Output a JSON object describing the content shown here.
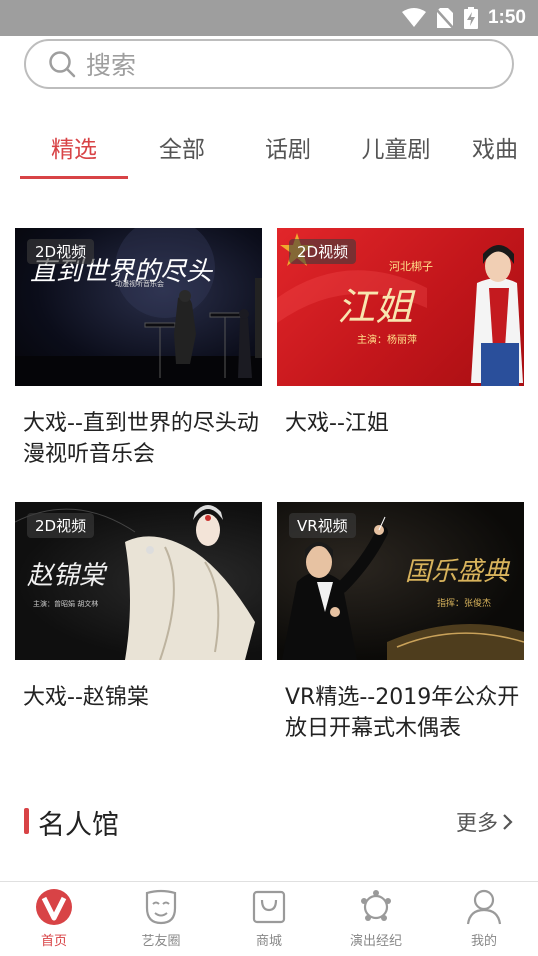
{
  "status_bar": {
    "time": "1:50"
  },
  "search": {
    "placeholder": "搜索"
  },
  "tabs": [
    {
      "label": "精选",
      "active": true
    },
    {
      "label": "全部",
      "active": false
    },
    {
      "label": "话剧",
      "active": false
    },
    {
      "label": "儿童剧",
      "active": false
    },
    {
      "label": "戏曲",
      "active": false
    }
  ],
  "cards": [
    {
      "badge": "2D视频",
      "title": "大戏--直到世界的尽头动漫视听音乐会",
      "thumb_text": "直到世界的尽头",
      "thumb_sub": "动漫视听音乐会"
    },
    {
      "badge": "2D视频",
      "title": "大戏--江姐",
      "thumb_text": "江姐",
      "thumb_top": "河北梆子",
      "thumb_sub": "主演：杨丽萍"
    },
    {
      "badge": "2D视频",
      "title": "大戏--赵锦棠",
      "thumb_text": "赵锦棠",
      "thumb_sub": "主演：曾昭娟 胡文林"
    },
    {
      "badge": "VR视频",
      "title": "VR精选--2019年公众开放日开幕式木偶表",
      "thumb_text": "国乐盛典",
      "thumb_sub": "指挥：张俊杰"
    }
  ],
  "section": {
    "title": "名人馆",
    "more_label": "更多"
  },
  "bottom_nav": [
    {
      "label": "首页",
      "icon": "home-v-icon",
      "active": true
    },
    {
      "label": "艺友圈",
      "icon": "mask-icon",
      "active": false
    },
    {
      "label": "商城",
      "icon": "shopping-bag-icon",
      "active": false
    },
    {
      "label": "演出经纪",
      "icon": "agency-icon",
      "active": false
    },
    {
      "label": "我的",
      "icon": "user-icon",
      "active": false
    }
  ],
  "colors": {
    "accent": "#d84346",
    "status_bar": "#9e9e9e"
  }
}
